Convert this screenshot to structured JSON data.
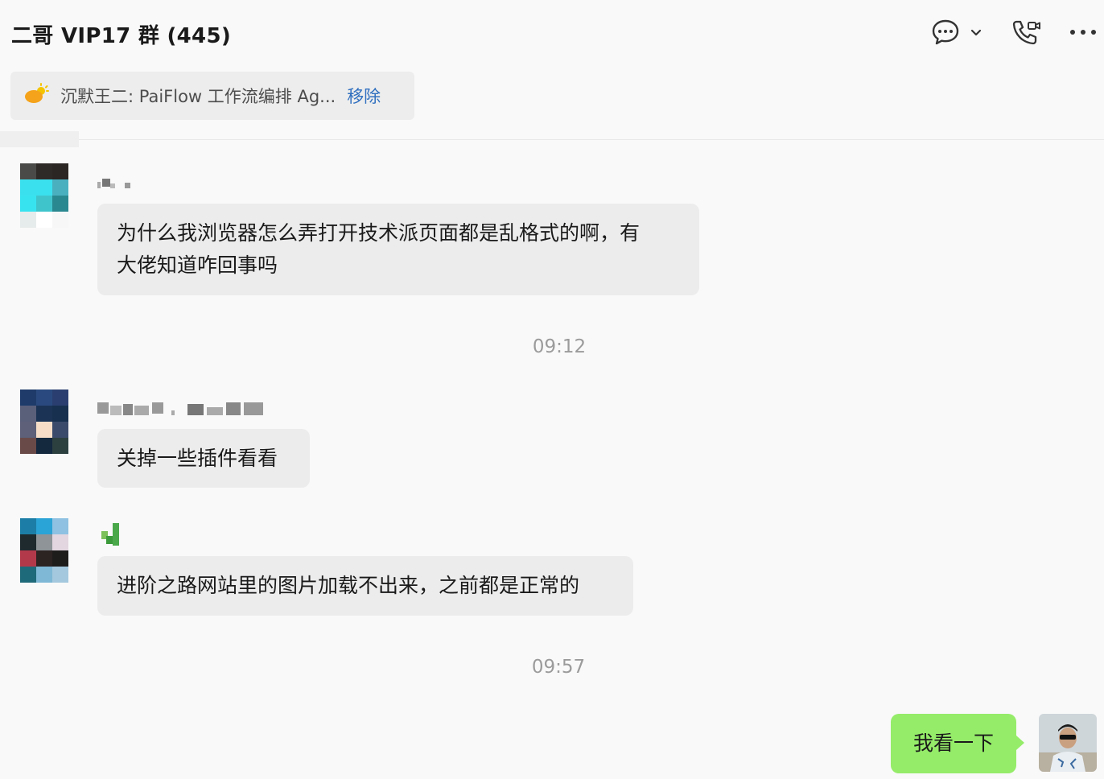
{
  "header": {
    "title": "二哥 VIP17 群 (445)"
  },
  "pinned": {
    "text": "沉默王二: PaiFlow 工作流编排 Ag...",
    "remove_label": "移除"
  },
  "messages": [
    {
      "text_line1": "为什么我浏览器怎么弄打开技术派页面都是乱格式的啊，有",
      "text_line2": "大佬知道咋回事吗"
    },
    {
      "text": "关掉一些插件看看"
    },
    {
      "text": "进阶之路网站里的图片加载不出来，之前都是正常的"
    }
  ],
  "timestamps": [
    "09:12",
    "09:57"
  ],
  "my_message": {
    "text": "我看一下"
  },
  "colors": {
    "bubble_other": "#ececed",
    "bubble_mine": "#95ec69",
    "link": "#2f6fbf"
  }
}
